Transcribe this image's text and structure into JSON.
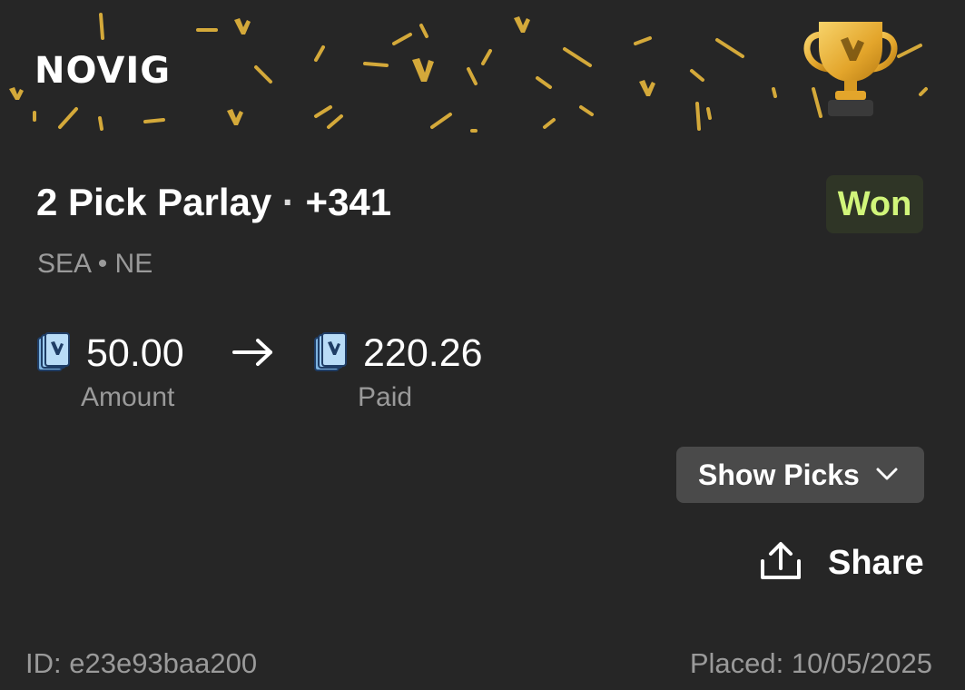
{
  "header": {
    "logo_text": "NOVIG",
    "trophy_icon": "trophy-icon",
    "confetti_color": "#d4a93a"
  },
  "bet": {
    "title": "2 Pick Parlay",
    "separator": "·",
    "odds": "+341",
    "status": "Won",
    "status_color": "#d1f57a",
    "teams": "SEA • NE"
  },
  "amounts": {
    "stake_value": "50.00",
    "stake_label": "Amount",
    "paid_value": "220.26",
    "paid_label": "Paid",
    "coin_icon": "novig-coin-icon",
    "arrow_icon": "arrow-right-icon"
  },
  "actions": {
    "show_picks_label": "Show Picks",
    "share_label": "Share"
  },
  "footer": {
    "id_text": "ID: e23e93baa200",
    "placed_text": "Placed: 10/05/2025"
  },
  "colors": {
    "background": "#262626",
    "muted_text": "#9a9a9a",
    "button_bg": "#4a4a4a",
    "badge_bg": "#2f3526"
  }
}
